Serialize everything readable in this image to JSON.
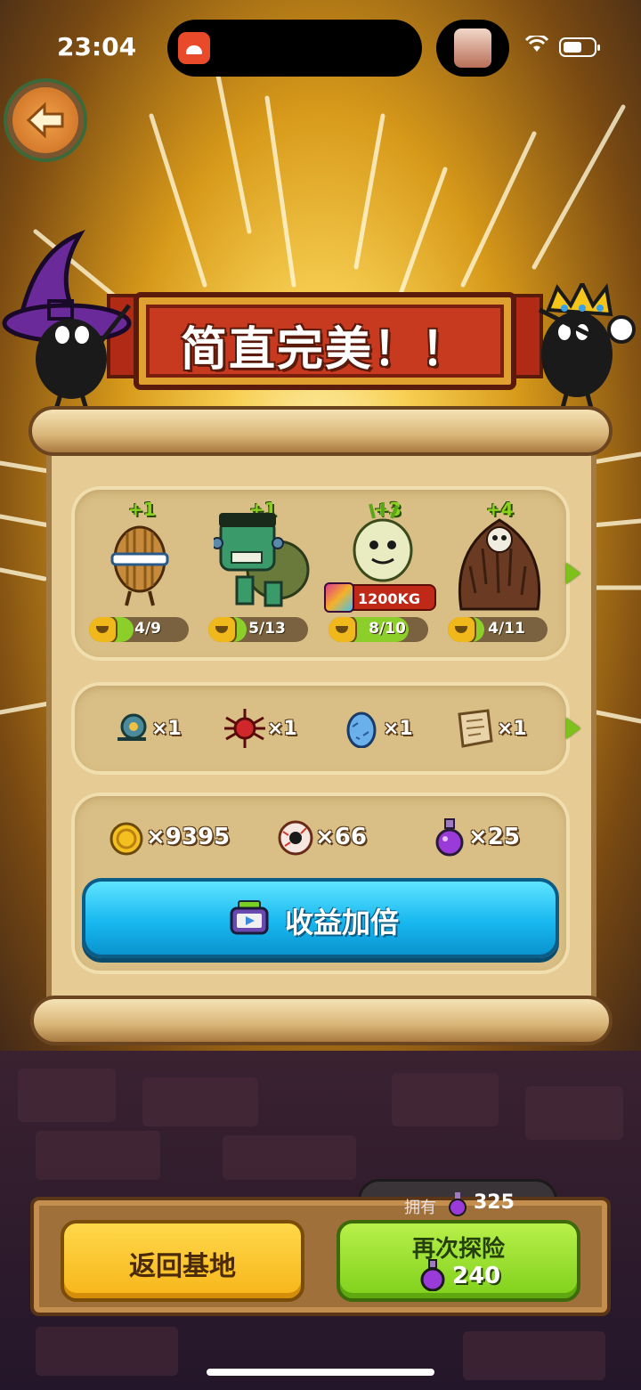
{
  "status_bar": {
    "time": "23:04"
  },
  "banner": {
    "title": "简直完美！！"
  },
  "monsters": [
    {
      "name": "shell-monster",
      "bonus": "+1",
      "progress": "4/9",
      "current": 4,
      "total": 9
    },
    {
      "name": "frankenstein-turtle",
      "bonus": "+1",
      "progress": "5/13",
      "current": 5,
      "total": 13
    },
    {
      "name": "cactus-monster",
      "bonus": "+3",
      "progress": "8/10",
      "current": 8,
      "total": 10,
      "weight": "1200KG"
    },
    {
      "name": "hairy-skull-monster",
      "bonus": "+4",
      "progress": "4/11",
      "current": 4,
      "total": 11
    }
  ],
  "items": [
    {
      "icon": "snail-icon",
      "count": "×1"
    },
    {
      "icon": "red-spider-icon",
      "count": "×1"
    },
    {
      "icon": "blue-egg-icon",
      "count": "×1"
    },
    {
      "icon": "scroll-map-icon",
      "count": "×1"
    }
  ],
  "resources": [
    {
      "icon": "gold-coin-icon",
      "count": "×9395"
    },
    {
      "icon": "eyeball-icon",
      "count": "×66"
    },
    {
      "icon": "purple-potion-icon",
      "count": "×25"
    }
  ],
  "double_button": {
    "label": "收益加倍",
    "icon": "tv-video-icon"
  },
  "bottom": {
    "owned_label": "拥有",
    "owned_value": "325",
    "base_button": "返回基地",
    "again_button": "再次探险",
    "again_cost": "240"
  },
  "colors": {
    "accent_green": "#8ccf2a",
    "double_blue": "#18b8f0",
    "banner_red": "#c83a1f"
  }
}
